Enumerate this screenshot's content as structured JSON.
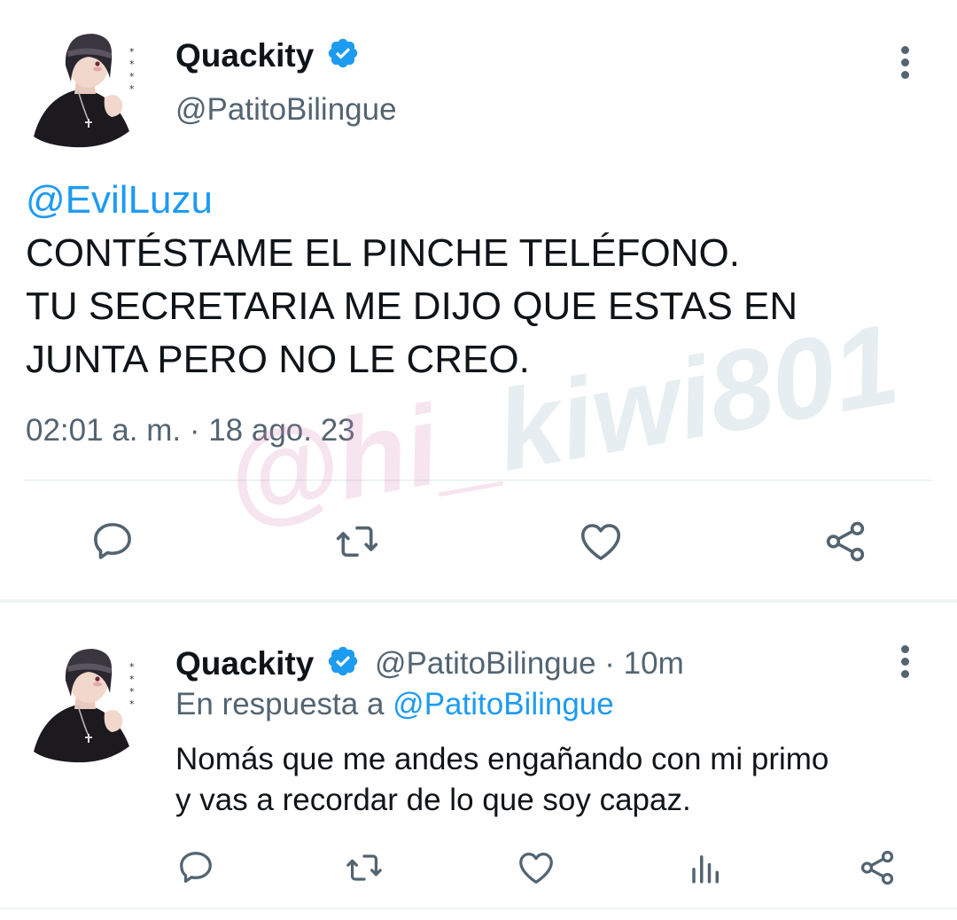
{
  "main_tweet": {
    "author_name": "Quackity",
    "handle": "@PatitoBilingue",
    "mention": "@EvilLuzu",
    "text_lines": [
      "CONTÉSTAME EL PINCHE TELÉFONO.",
      "TU SECRETARIA ME DIJO QUE ESTAS EN",
      "JUNTA PERO NO LE CREO."
    ],
    "timestamp": "02:01 a. m. · 18 ago. 23",
    "actions": [
      "reply-icon",
      "retweet-icon",
      "like-icon",
      "share-icon"
    ]
  },
  "reply_tweet": {
    "author_name": "Quackity",
    "handle_time": "@PatitoBilingue · 10m",
    "replying_prefix": "En respuesta a",
    "replying_to": "@PatitoBilingue",
    "text_lines": [
      "Nomás que me andes engañando con mi primo",
      "y vas a recordar de lo que soy capaz."
    ],
    "actions": [
      "reply-icon",
      "retweet-icon",
      "like-icon",
      "analytics-icon",
      "share-icon"
    ]
  },
  "watermark": {
    "part1": "@hi_",
    "part2": "kiwi801"
  },
  "colors": {
    "accent": "#1d9bf0",
    "text": "#0f1419",
    "secondary": "#536471",
    "divider": "#eff3f4"
  }
}
